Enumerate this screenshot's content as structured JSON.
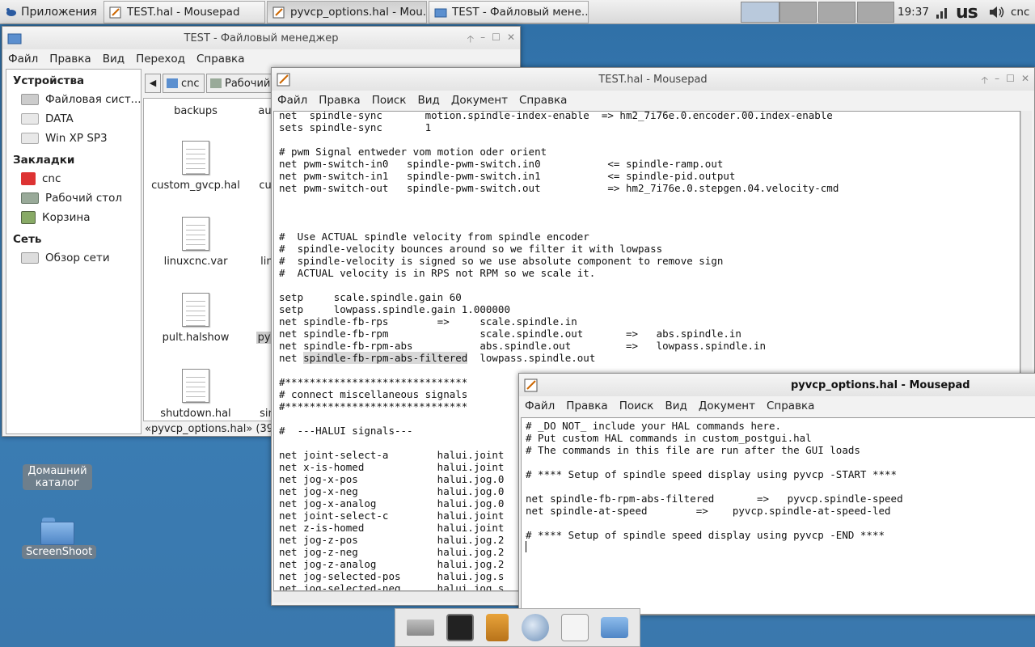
{
  "panel": {
    "apps_label": "Приложения",
    "tasks": [
      {
        "label": "TEST.hal - Mousepad"
      },
      {
        "label": "pyvcp_options.hal - Mou..."
      },
      {
        "label": "TEST - Файловый мене..."
      }
    ],
    "clock": "19:37",
    "keyboard_layout": "us",
    "user": "cnc"
  },
  "desktop": {
    "home_label": "Домашний каталог",
    "screenshoot_label": "ScreenShoot"
  },
  "file_manager": {
    "title": "TEST - Файловый менеджер",
    "menu": [
      "Файл",
      "Правка",
      "Вид",
      "Переход",
      "Справка"
    ],
    "path": [
      "cnc",
      "Рабочий"
    ],
    "sidebar": {
      "devices_header": "Устройства",
      "devices": [
        "Файловая сист...",
        "DATA",
        "Win XP SP3"
      ],
      "bookmarks_header": "Закладки",
      "bookmarks": [
        "cnc",
        "Рабочий стол",
        "Корзина"
      ],
      "network_header": "Сеть",
      "network": [
        "Обзор сети"
      ]
    },
    "files": [
      "backups",
      "auto",
      "custom_gvcp.hal",
      "cust",
      "linuxcnc.var",
      "linu",
      "pult.halshow",
      "pyvc",
      "shutdown.hal",
      "sinc"
    ],
    "status": "«pyvcp_options.hal» (39"
  },
  "test_hal": {
    "title": "TEST.hal - Mousepad",
    "menu": [
      "Файл",
      "Правка",
      "Поиск",
      "Вид",
      "Документ",
      "Справка"
    ],
    "lines_top": "net  spindle-sync       motion.spindle-index-enable  => hm2_7i76e.0.encoder.00.index-enable\nsets spindle-sync       1\n\n# pwm Signal entweder vom motion oder orient\nnet pwm-switch-in0   spindle-pwm-switch.in0           <= spindle-ramp.out\nnet pwm-switch-in1   spindle-pwm-switch.in1           <= spindle-pid.output\nnet pwm-switch-out   spindle-pwm-switch.out           => hm2_7i76e.0.stepgen.04.velocity-cmd\n\n\n\n#  Use ACTUAL spindle velocity from spindle encoder\n#  spindle-velocity bounces around so we filter it with lowpass\n#  spindle-velocity is signed so we use absolute component to remove sign\n#  ACTUAL velocity is in RPS not RPM so we scale it.\n\nsetp     scale.spindle.gain 60\nsetp     lowpass.spindle.gain 1.000000\nnet spindle-fb-rps        =>     scale.spindle.in\nnet spindle-fb-rpm               scale.spindle.out       =>   abs.spindle.in\nnet spindle-fb-rpm-abs           abs.spindle.out         =>   lowpass.spindle.in",
    "hl_prefix": "net ",
    "hl_text": "spindle-fb-rpm-abs-filtered",
    "hl_suffix": "  lowpass.spindle.out",
    "lines_bottom": "\n#******************************\n# connect miscellaneous signals\n#******************************\n\n#  ---HALUI signals---\n\nnet joint-select-a        halui.joint\nnet x-is-homed            halui.joint\nnet jog-x-pos             halui.jog.0\nnet jog-x-neg             halui.jog.0\nnet jog-x-analog          halui.jog.0\nnet joint-select-c        halui.joint\nnet z-is-homed            halui.joint\nnet jog-z-pos             halui.jog.2\nnet jog-z-neg             halui.jog.2\nnet jog-z-analog          halui.jog.2\nnet jog-selected-pos      halui.jog.s\nnet jog-selected-neg      halui.jog.s"
  },
  "pyvcp": {
    "title": "pyvcp_options.hal - Mousepad",
    "menu": [
      "Файл",
      "Правка",
      "Поиск",
      "Вид",
      "Документ",
      "Справка"
    ],
    "content": "# _DO NOT_ include your HAL commands here.\n# Put custom HAL commands in custom_postgui.hal\n# The commands in this file are run after the GUI loads\n\n# **** Setup of spindle speed display using pyvcp -START ****\n\nnet spindle-fb-rpm-abs-filtered       =>   pyvcp.spindle-speed\nnet spindle-at-speed        =>    pyvcp.spindle-at-speed-led\n\n# **** Setup of spindle speed display using pyvcp -END ****\n"
  }
}
